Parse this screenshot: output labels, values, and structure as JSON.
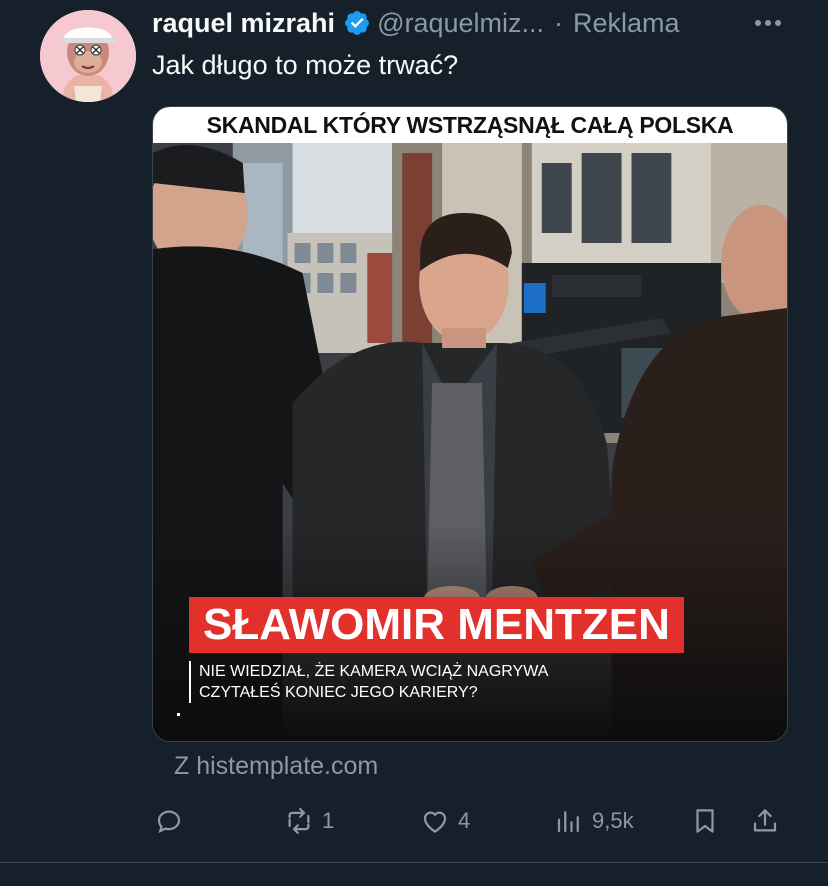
{
  "tweet": {
    "author_name": "raquel mizrahi",
    "handle": "@raquelmiz...",
    "separator": "·",
    "ad_label": "Reklama",
    "text": "Jak długo to może trwać?",
    "source": "Z histemplate.com"
  },
  "media": {
    "banner": "SKANDAL KTÓRY WSTRZĄSNĄŁ CAŁĄ POLSKA",
    "name_overlay": "SŁAWOMIR MENTZEN",
    "sub_line1": "NIE WIEDZIAŁ, ŻE KAMERA WCIĄŻ NAGRYWA",
    "sub_line2": "CZYTAŁEŚ KONIEC JEGO KARIERY?"
  },
  "actions": {
    "reply": {
      "icon": "reply-icon",
      "count": ""
    },
    "retweet": {
      "icon": "retweet-icon",
      "count": "1"
    },
    "like": {
      "icon": "heart-icon",
      "count": "4"
    },
    "views": {
      "icon": "views-icon",
      "count": "9,5k"
    },
    "bookmark": {
      "icon": "bookmark-icon"
    },
    "share": {
      "icon": "share-icon"
    }
  },
  "colors": {
    "background": "#15202b",
    "muted": "#8b98a5",
    "verified": "#1d9bf0",
    "name_box": "#e2312d"
  }
}
